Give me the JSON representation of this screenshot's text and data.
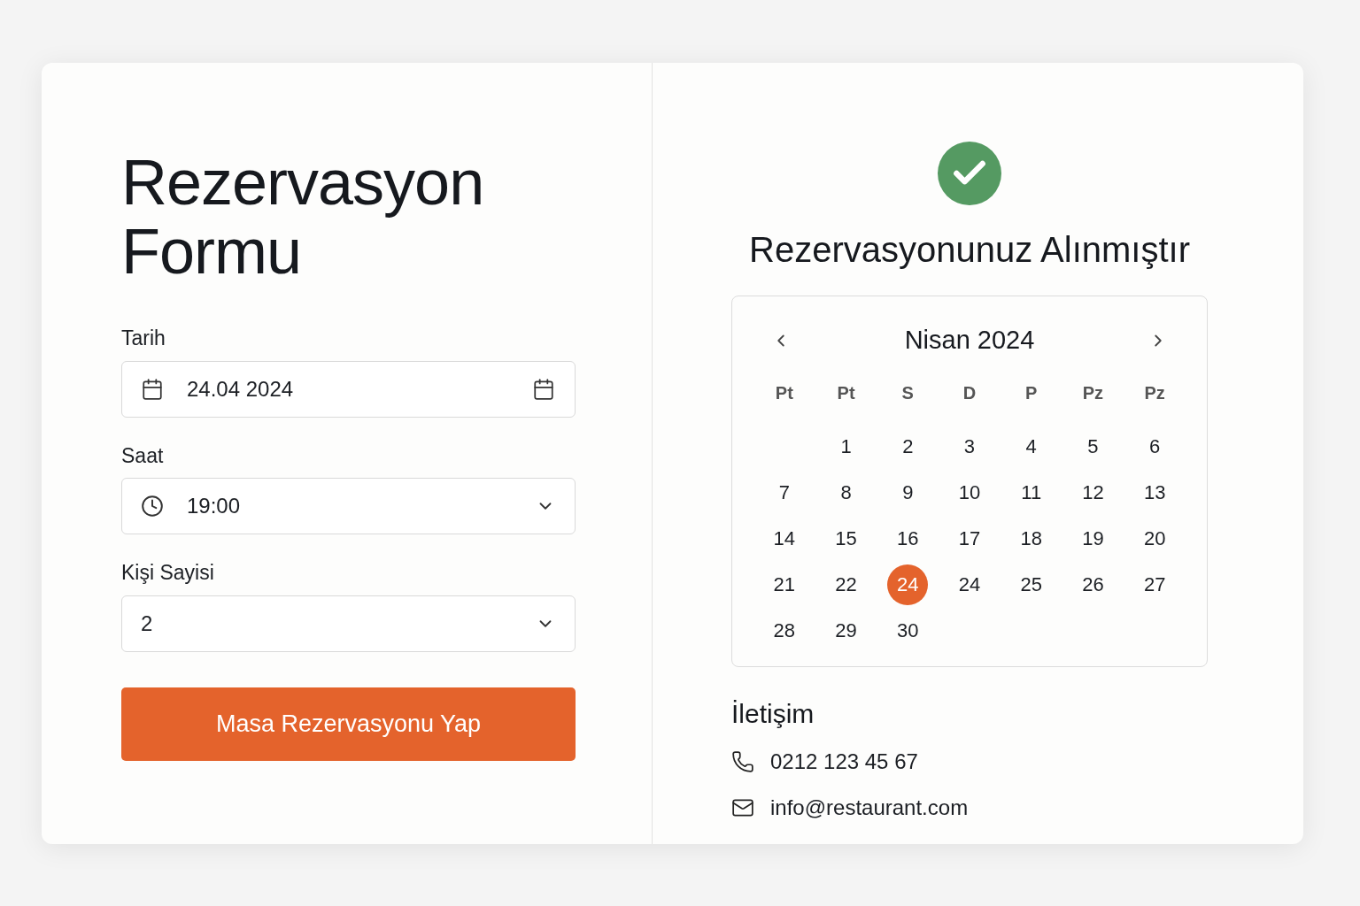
{
  "form": {
    "title": "Rezervasyon Formu",
    "fields": [
      {
        "kind": "date",
        "label": "Tarih",
        "value": "24.04 2024"
      },
      {
        "kind": "time",
        "label": "Saat",
        "value": "19:00"
      },
      {
        "kind": "select",
        "label": "Kişi Sayisi",
        "value": "2"
      }
    ],
    "submit": "Masa Rezervasyonu Yap"
  },
  "confirmation": {
    "title": "Rezervasyonunuz Alınmıştır",
    "calendar": {
      "month": "Nisan 2024",
      "weekdays": [
        "Pt",
        "Pt",
        "S",
        "D",
        "P",
        "Pz",
        "Pz"
      ],
      "weeks": [
        {
          "days": [
            {
              "label": "1",
              "selected": false
            },
            {
              "label": "2",
              "selected": false
            },
            {
              "label": "3",
              "selected": false
            },
            {
              "label": "4",
              "selected": false
            },
            {
              "label": "5",
              "selected": false
            },
            {
              "label": "6",
              "selected": false
            }
          ]
        },
        {
          "days": [
            {
              "label": "7",
              "selected": false
            },
            {
              "label": "8",
              "selected": false
            },
            {
              "label": "9",
              "selected": false
            },
            {
              "label": "10",
              "selected": false
            },
            {
              "label": "11",
              "selected": false
            },
            {
              "label": "12",
              "selected": false
            },
            {
              "label": "13",
              "selected": false
            }
          ]
        },
        {
          "days": [
            {
              "label": "14",
              "selected": false
            },
            {
              "label": "15",
              "selected": false
            },
            {
              "label": "16",
              "selected": false
            },
            {
              "label": "17",
              "selected": false
            },
            {
              "label": "18",
              "selected": false
            },
            {
              "label": "19",
              "selected": false
            },
            {
              "label": "20",
              "selected": false
            }
          ]
        },
        {
          "days": [
            {
              "label": "21",
              "selected": false
            },
            {
              "label": "22",
              "selected": false
            },
            {
              "label": "24",
              "selected": true
            },
            {
              "label": "24",
              "selected": false
            },
            {
              "label": "25",
              "selected": false
            },
            {
              "label": "26",
              "selected": false
            },
            {
              "label": "27",
              "selected": false
            }
          ]
        },
        {
          "days": [
            {
              "label": "28",
              "selected": false
            },
            {
              "label": "29",
              "selected": false
            },
            {
              "label": "30",
              "selected": false
            }
          ]
        }
      ]
    },
    "contact": {
      "title": "İletişim",
      "items": [
        {
          "kind": "phone",
          "text": "0212 123 45 67"
        },
        {
          "kind": "email",
          "text": "info@restaurant.com"
        }
      ]
    }
  }
}
